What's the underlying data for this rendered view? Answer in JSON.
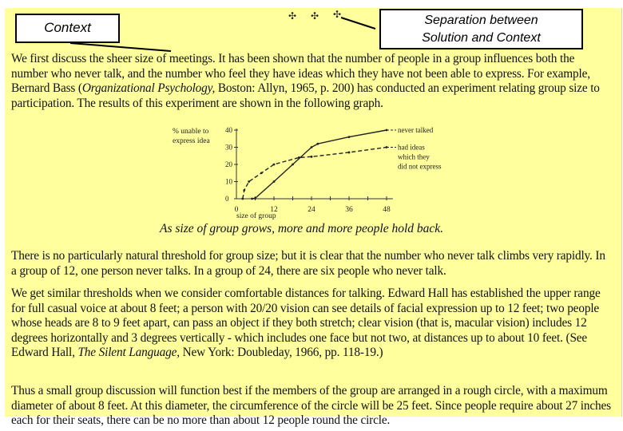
{
  "callouts": {
    "context": "Context",
    "separation_line1": "Separation between",
    "separation_line2": "Solution and Context"
  },
  "separator_marks": [
    "✣",
    "✣",
    "✣"
  ],
  "paragraphs": {
    "p1_a": "We first discuss the sheer size of meetings. It has been shown that the number of people in a group influences both the number who never talk, and the number who feel they have ideas which they have not been able to express. For example, Bernard Bass (",
    "p1_title": "Organizational Psychology,",
    "p1_b": " Boston: Allyn, 1965, p. 200) has conducted an experiment relating group size to participation. The results of this experiment are shown in the following graph.",
    "p2": "There is no particularly natural threshold for group size; but it is clear that the number who never talk climbs very rapidly. In a group of 12, one person never talks. In a group of 24, there are six people who never talk.",
    "p3_a": "We get similar thresholds when we consider comfortable distances for talking. Edward Hall has established the upper range for full casual voice at about 8 feet; a person with 20/20 vision can see details of facial expression up to 12 feet; two people whose heads are 8 to 9 feet apart, can pass an object if they both stretch; clear vision (that is, macular vision) includes 12 degrees horizontally and 3 degrees vertically - which includes one face but not two, at distances up to about 10 feet. (See Edward Hall, ",
    "p3_title": "The Silent Language,",
    "p3_b": " New York: Doubleday, 1966, pp. 118-19.)",
    "p4": "Thus a small group discussion will function best if the members of the group are arranged in a rough circle, with a maximum diameter of about 8 feet. At this diameter, the circumference of the circle will be 25 feet. Since people require about 27 inches each for their seats, there can be no more than about 12 people round the circle."
  },
  "figure_caption": "As size of group grows, more and more people hold back.",
  "chart_data": {
    "type": "line",
    "title": "",
    "xlabel": "size of group",
    "ylabel_line1": "% unable to",
    "ylabel_line2": "express idea",
    "xlim": [
      0,
      50
    ],
    "ylim": [
      0,
      40
    ],
    "x_ticks": [
      0,
      12,
      24,
      36,
      48
    ],
    "y_ticks": [
      0,
      10,
      20,
      30,
      40
    ],
    "grid": false,
    "series": [
      {
        "name": "never talked",
        "label_lines": [
          "never talked"
        ],
        "style": "solid",
        "x": [
          5,
          6,
          12,
          18,
          24,
          26,
          36,
          48
        ],
        "y": [
          0,
          0.3,
          10,
          20,
          30,
          32,
          36,
          40
        ]
      },
      {
        "name": "had ideas which they did not express",
        "label_lines": [
          "had ideas",
          "which they",
          "did not express"
        ],
        "style": "dashed",
        "x": [
          2,
          2.5,
          4,
          8,
          12,
          20,
          24,
          36,
          48
        ],
        "y": [
          0,
          5,
          10,
          15,
          20,
          24,
          24.5,
          27,
          30
        ]
      }
    ]
  }
}
